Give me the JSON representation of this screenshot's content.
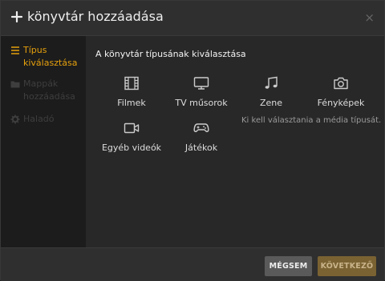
{
  "header": {
    "title": "könyvtár hozzáadása",
    "close_label": "×"
  },
  "sidebar": {
    "items": [
      {
        "label": "Típus kiválasztása",
        "icon": "list-icon",
        "state": "active"
      },
      {
        "label": "Mappák hozzáadása",
        "icon": "folder-icon",
        "state": "disabled"
      },
      {
        "label": "Haladó",
        "icon": "gear-icon",
        "state": "disabled"
      }
    ]
  },
  "main": {
    "section_title": "A könyvtár típusának kiválasztása",
    "types": [
      {
        "label": "Filmek",
        "icon": "film-icon"
      },
      {
        "label": "TV műsorok",
        "icon": "tv-icon"
      },
      {
        "label": "Zene",
        "icon": "music-icon"
      },
      {
        "label": "Fényképek",
        "icon": "camera-icon"
      },
      {
        "label": "Egyéb videók",
        "icon": "video-camera-icon"
      },
      {
        "label": "Játékok",
        "icon": "gamepad-icon"
      }
    ],
    "hint": "Ki kell választania a média típusát."
  },
  "footer": {
    "cancel_label": "MÉGSEM",
    "next_label": "KÖVETKEZŐ",
    "next_enabled": false
  },
  "colors": {
    "accent": "#e5a00d",
    "background": "#282828",
    "sidebar": "#1c1c1c",
    "header": "#2f2f2f"
  }
}
